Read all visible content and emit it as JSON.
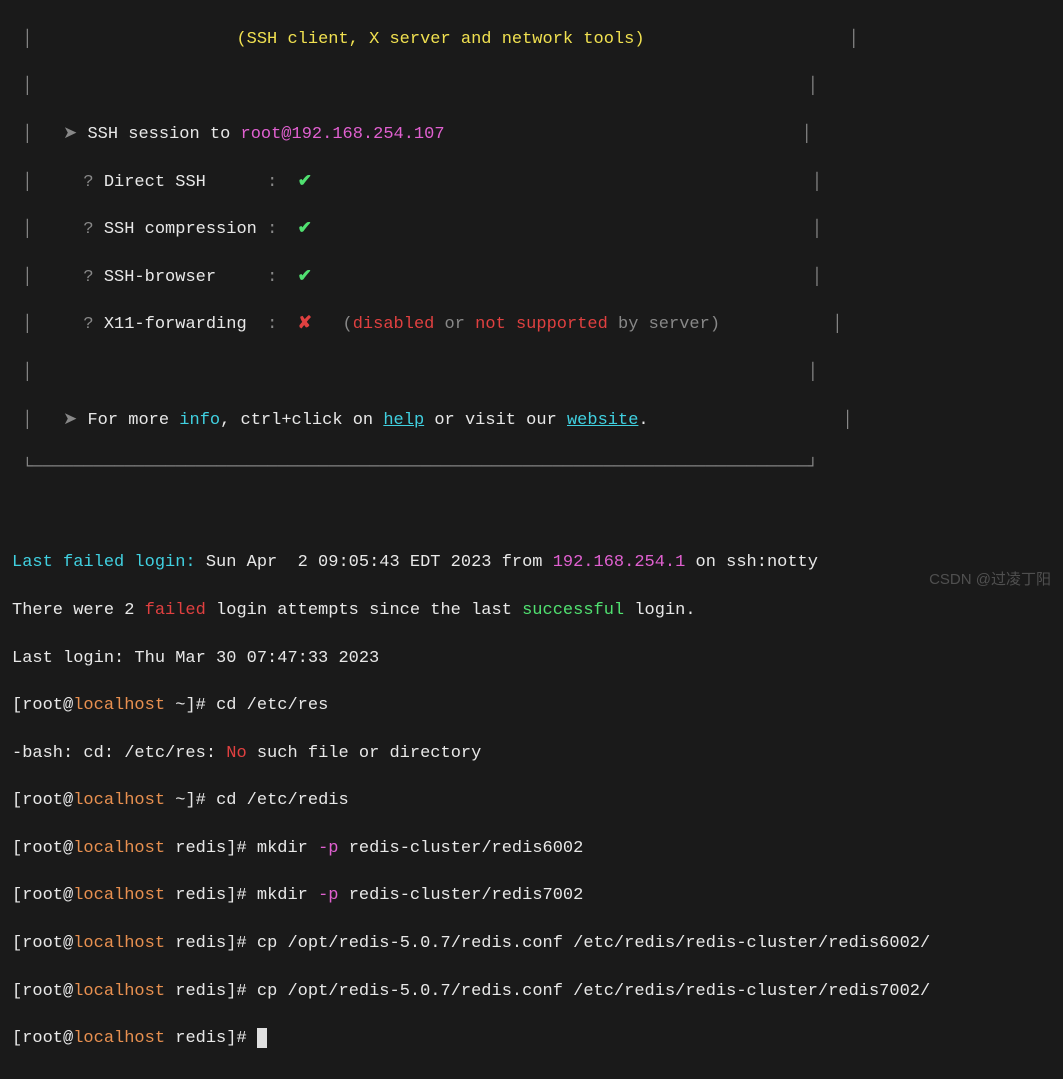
{
  "banner": {
    "subtitle": "(SSH client, X server and network tools)",
    "session_label": "SSH session to",
    "session_target": "root@192.168.254.107",
    "items": [
      {
        "label": "Direct SSH",
        "status": "check"
      },
      {
        "label": "SSH compression",
        "status": "check"
      },
      {
        "label": "SSH-browser",
        "status": "check"
      },
      {
        "label": "X11-forwarding",
        "status": "cross",
        "note_parts": [
          "(",
          "disabled",
          " or ",
          "not supported",
          " by server)"
        ]
      }
    ],
    "footer_prefix": "For more ",
    "footer_info": "info",
    "footer_mid1": ", ctrl+click on ",
    "footer_help": "help",
    "footer_mid2": " or visit our ",
    "footer_website": "website",
    "footer_end": "."
  },
  "login": {
    "last_failed_label": "Last failed login:",
    "last_failed_time": " Sun Apr  2 09:05:43 EDT 2023 from ",
    "last_failed_ip": "192.168.254.1",
    "last_failed_suffix": " on ssh:notty",
    "attempts_prefix": "There were 2 ",
    "attempts_failed": "failed",
    "attempts_mid": " login attempts since the last ",
    "attempts_success": "successful",
    "attempts_suffix": " login.",
    "last_login": "Last login: Thu Mar 30 07:47:33 2023"
  },
  "prompt": {
    "user_open": "[root@",
    "host": "localhost",
    "home_dir": " ~",
    "redis_dir": " redis",
    "close": "]# "
  },
  "commands": {
    "cd_res": "cd /etc/res",
    "bash_error_prefix": "-bash: cd: /etc/res: ",
    "bash_error_no": "No",
    "bash_error_suffix": " such file or directory",
    "cd_redis": "cd /etc/redis",
    "mkdir1_pre": "mkdir ",
    "mkdir_flag": "-p",
    "mkdir1_path": " redis-cluster/redis6002",
    "mkdir2_path": " redis-cluster/redis7002",
    "cp1": "cp /opt/redis-5.0.7/redis.conf /etc/redis/redis-cluster/redis6002/",
    "cp2": "cp /opt/redis-5.0.7/redis.conf /etc/redis/redis-cluster/redis7002/"
  },
  "watermark": "CSDN @过凌丁阳"
}
